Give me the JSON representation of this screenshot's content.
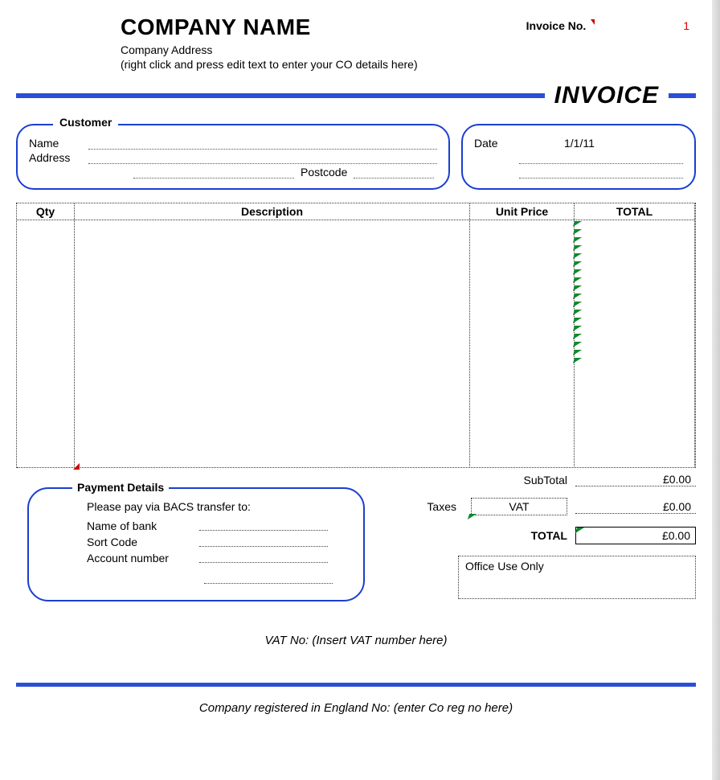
{
  "header": {
    "company_name": "COMPANY NAME",
    "company_address": "Company Address",
    "company_hint": "(right click and press edit text to enter your CO details here)",
    "invoice_no_label": "Invoice No.",
    "invoice_no_value": "1",
    "invoice_title": "INVOICE"
  },
  "customer": {
    "tab": "Customer",
    "name_label": "Name",
    "address_label": "Address",
    "postcode_label": "Postcode"
  },
  "date": {
    "label": "Date",
    "value": "1/1/11"
  },
  "items": {
    "qty_label": "Qty",
    "desc_label": "Description",
    "unit_label": "Unit Price",
    "total_label": "TOTAL"
  },
  "totals": {
    "subtotal_label": "SubTotal",
    "subtotal_value": "£0.00",
    "taxes_label": "Taxes",
    "vat_label": "VAT",
    "vat_value": "£0.00",
    "total_label": "TOTAL",
    "total_value": "£0.00"
  },
  "payment": {
    "title": "Payment Details",
    "instruction": "Please pay via BACS transfer to:",
    "bank_label": "Name of bank",
    "sort_label": "Sort Code",
    "account_label": "Account number"
  },
  "office": {
    "label": "Office Use Only"
  },
  "footer": {
    "vat_line": "VAT No: (Insert VAT number here)",
    "reg_line": "Company registered in England No: (enter Co reg no here)"
  }
}
